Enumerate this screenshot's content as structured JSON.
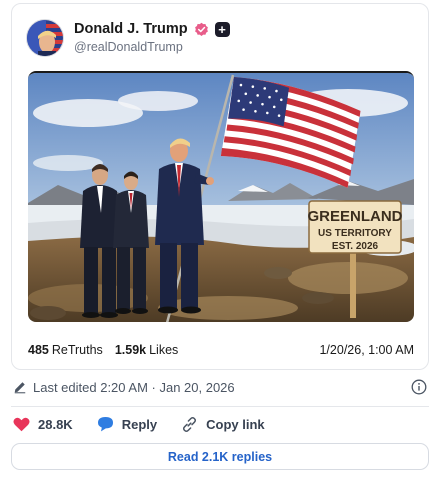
{
  "post": {
    "display_name": "Donald J. Trump",
    "handle": "@realDonaldTrump",
    "image": {
      "sign_line1": "GREENLAND",
      "sign_line2": "US TERRITORY",
      "sign_line3": "EST. 2026"
    },
    "stats": {
      "retruths_count": "485",
      "retruths_label": "ReTruths",
      "likes_count": "1.59k",
      "likes_label": "Likes",
      "timestamp": "1/20/26, 1:00 AM"
    }
  },
  "edited": {
    "text": "Last edited 2:20 AM · Jan 20, 2026"
  },
  "actions": {
    "like_count": "28.8K",
    "reply_label": "Reply",
    "copy_link_label": "Copy link"
  },
  "read_replies_label": "Read 2.1K replies",
  "icons": {
    "verified": "verified-badge-icon",
    "plus": "plus-badge-icon",
    "pencil": "pencil-icon",
    "info": "info-icon",
    "heart": "heart-icon",
    "reply": "speech-bubble-icon",
    "link": "link-icon"
  },
  "colors": {
    "heart": "#e8355a",
    "reply": "#2f7de1",
    "link_text": "#2563c9",
    "verified": "#e85d8a"
  }
}
